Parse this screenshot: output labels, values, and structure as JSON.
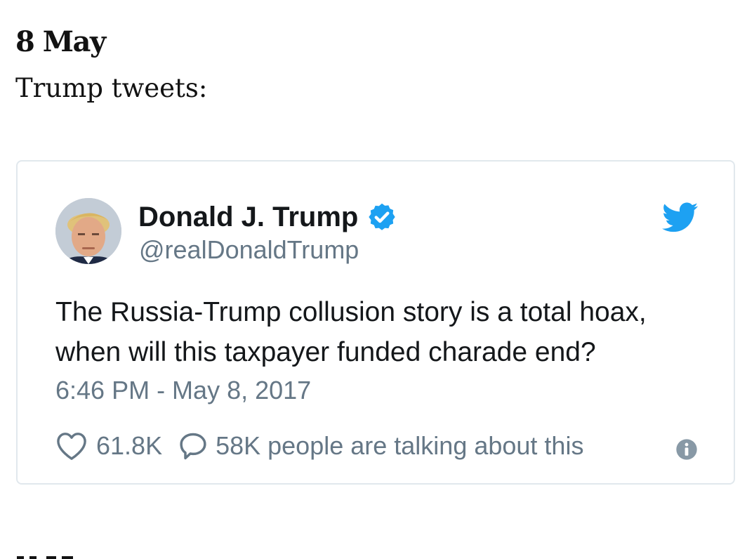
{
  "entry": {
    "date": "8 May",
    "intro": "Trump tweets:"
  },
  "tweet": {
    "author_name": "Donald J. Trump",
    "author_handle": "@realDonaldTrump",
    "text": "The Russia-Trump collusion story is a total hoax, when will this taxpayer funded charade end?",
    "timestamp": "6:46 PM - May 8, 2017",
    "likes": "61.8K",
    "talking": "58K people are talking about this",
    "icons": {
      "avatar": "avatar",
      "verified": "verified-badge-icon",
      "brand": "twitter-bird-icon",
      "like": "heart-icon",
      "reply": "speech-bubble-icon",
      "info": "info-icon"
    }
  },
  "colors": {
    "text_primary": "#14171a",
    "text_secondary": "#657786",
    "twitter_blue": "#1da1f2",
    "card_border": "#e1e8ed",
    "page_text": "#121212"
  }
}
